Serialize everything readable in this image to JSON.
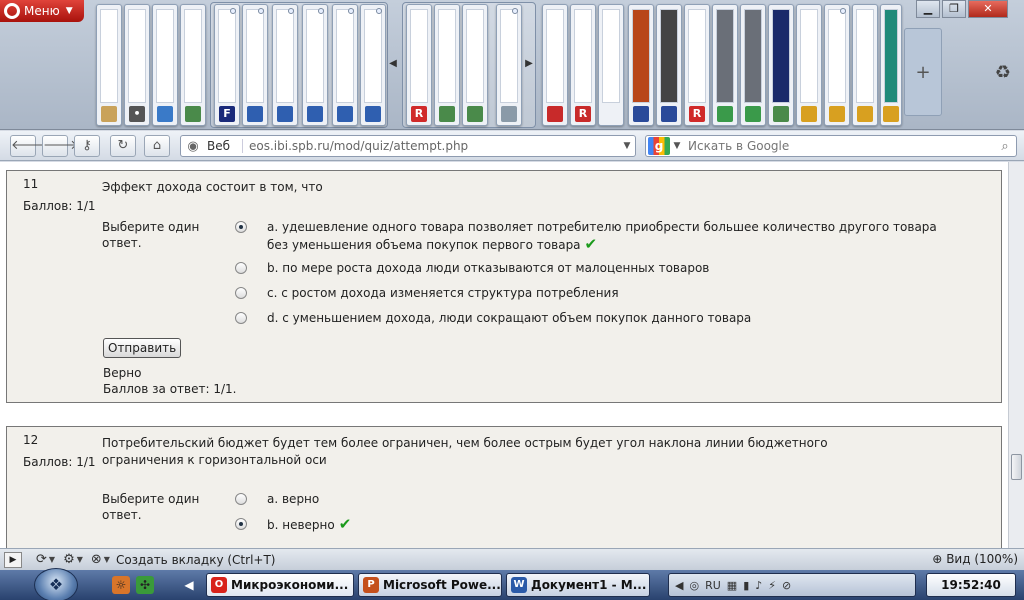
{
  "browser": {
    "menu_label": "Меню",
    "web_label": "Веб",
    "url": "eos.ibi.spb.ru/mod/quiz/attempt.php",
    "search_placeholder": "Искать в Google",
    "new_tab_label": "Создать вкладку (Ctrl+T)",
    "zoom_label": "Вид (100%)"
  },
  "questions": [
    {
      "number": "11",
      "grade": "Баллов: 1/1",
      "text": "Эффект дохода состоит в том, что",
      "prompt": "Выберите один ответ.",
      "answers": [
        {
          "text": "a. удешевление одного товара позволяет потребителю приобрести большее количество другого товара без уменьшения объема покупок первого товара",
          "selected": true,
          "correct": true
        },
        {
          "text": "b. по мере роста дохода люди отказываются от малоценных товаров",
          "selected": false,
          "correct": false
        },
        {
          "text": "c. с ростом дохода изменяется структура потребления",
          "selected": false,
          "correct": false
        },
        {
          "text": "d. с уменьшением дохода, люди сокращают объем покупок данного товара",
          "selected": false,
          "correct": false
        }
      ],
      "submit_label": "Отправить",
      "feedback_state": "Верно",
      "feedback_score": "Баллов за ответ: 1/1."
    },
    {
      "number": "12",
      "grade": "Баллов: 1/1",
      "text": "Потребительский бюджет будет тем более ограничен, чем более острым будет угол наклона линии бюджетного ограничения к горизонтальной оси",
      "prompt": "Выберите один ответ.",
      "answers": [
        {
          "text": "a. верно",
          "selected": false,
          "correct": false
        },
        {
          "text": "b. неверно",
          "selected": true,
          "correct": true
        }
      ]
    }
  ],
  "taskbar": {
    "tasks": [
      {
        "label": "Микроэкономи...",
        "icon": "opera-icon",
        "color": "#d8231b"
      },
      {
        "label": "Microsoft Powe...",
        "icon": "powerpoint-icon",
        "color": "#c4501c"
      },
      {
        "label": "Документ1 - М...",
        "icon": "word-icon",
        "color": "#2a5aa8"
      }
    ],
    "clock": "19:52:40",
    "tray_language": "RU"
  },
  "colors": {
    "correct_tick": "#1b9a1b",
    "question_bg": "#f2f0eb",
    "menu_red": "#c8231b"
  }
}
